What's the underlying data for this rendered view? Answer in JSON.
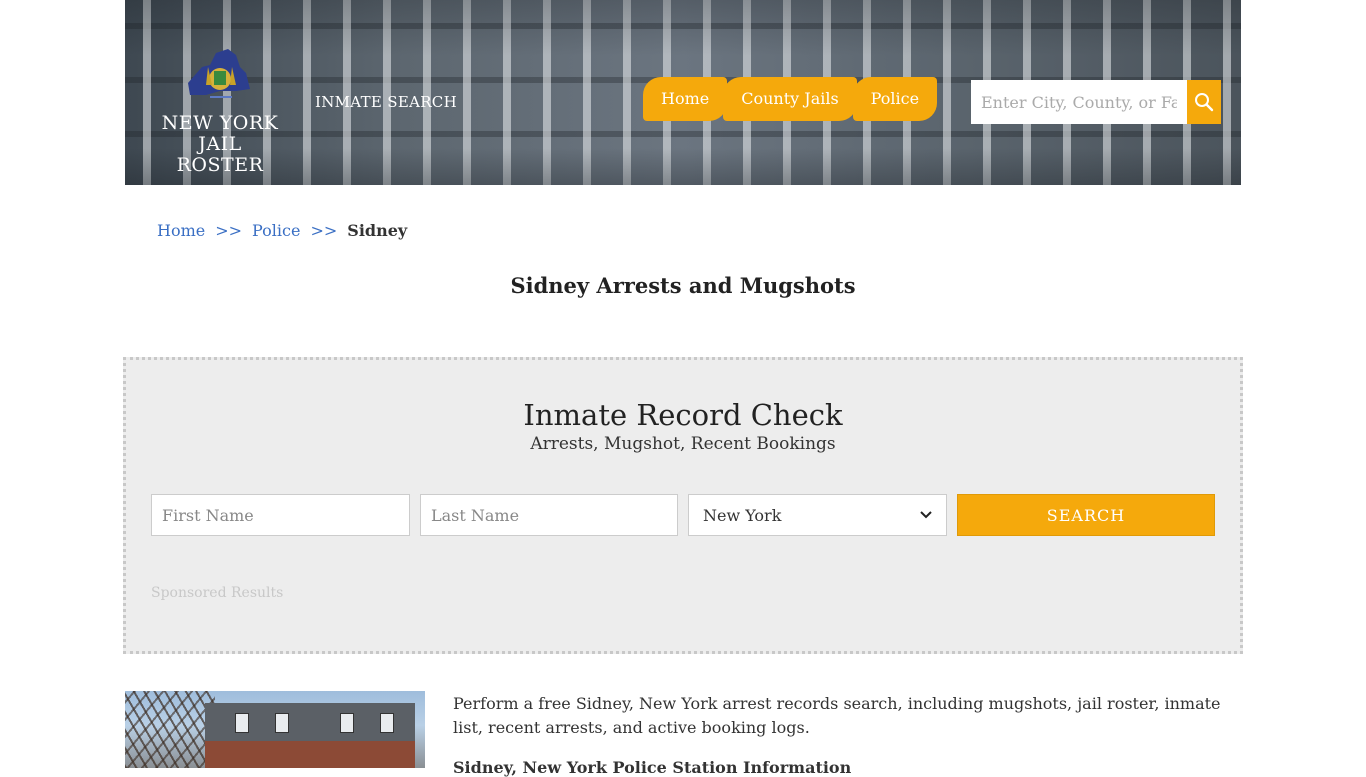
{
  "header": {
    "logo_line1": "NEW YORK",
    "logo_line2": "JAIL ROSTER",
    "inmate_search_link": "INMATE SEARCH",
    "nav": [
      "Home",
      "County Jails",
      "Police"
    ],
    "search_placeholder": "Enter City, County, or Facil"
  },
  "breadcrumb": {
    "items": [
      "Home",
      "Police"
    ],
    "separator": ">>",
    "current": "Sidney"
  },
  "page_title": "Sidney Arrests and Mugshots",
  "record_check": {
    "title": "Inmate Record Check",
    "subtitle": "Arrests, Mugshot, Recent Bookings",
    "first_name_placeholder": "First Name",
    "last_name_placeholder": "Last Name",
    "state_selected": "New York",
    "search_button": "SEARCH",
    "sponsored": "Sponsored Results"
  },
  "content": {
    "intro": "Perform a free Sidney, New York arrest records search, including mugshots, jail roster, inmate list, recent arrests, and active booking logs.",
    "subhead": "Sidney, New York Police Station Information"
  },
  "colors": {
    "accent": "#f5a90c",
    "link": "#3a6fc4",
    "panel_bg": "#ededed"
  },
  "icons": {
    "search": "magnifier",
    "logo": "new-york-state-seal"
  }
}
